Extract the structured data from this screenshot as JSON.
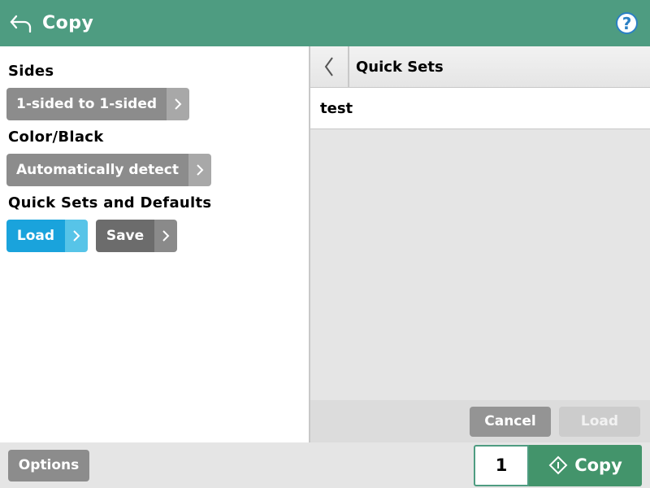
{
  "header": {
    "title": "Copy"
  },
  "left": {
    "sides_label": "Sides",
    "sides_value": "1-sided to 1-sided",
    "color_label": "Color/Black",
    "color_value": "Automatically detect",
    "qs_label": "Quick Sets and Defaults",
    "load_label": "Load",
    "save_label": "Save"
  },
  "right": {
    "panel_title": "Quick Sets",
    "items": [
      {
        "name": "test"
      }
    ],
    "cancel": "Cancel",
    "load": "Load"
  },
  "footer": {
    "options": "Options",
    "count": "1",
    "copy": "Copy"
  }
}
